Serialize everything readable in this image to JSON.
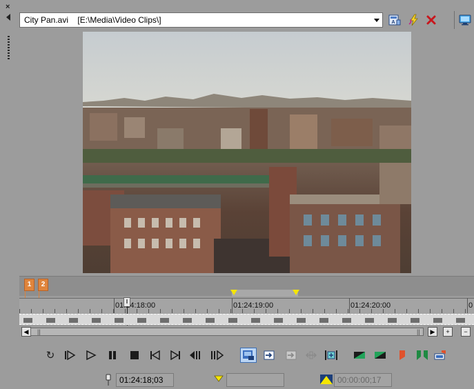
{
  "window": {
    "close_glyph": "×"
  },
  "toolbar": {
    "media_file": "City Pan.avi",
    "media_path": "[E:\\Media\\Video Clips\\]",
    "icons": [
      "media-properties-icon",
      "use-project-in-place-icon",
      "clear-trimmer-history-icon",
      "display-options-icon"
    ]
  },
  "timeline": {
    "markers": [
      {
        "label": "1"
      },
      {
        "label": "2"
      }
    ],
    "ruler_labels": [
      "01:24:18:00",
      "01:24:19:00",
      "01:24:20:00",
      "0"
    ],
    "cursor_label": "01:24:18:00"
  },
  "scrollbar": {
    "grip_left": "||",
    "grip_right": "||"
  },
  "transport": {
    "buttons": [
      "loop-playback-icon",
      "play-from-start-icon",
      "play-icon",
      "pause-icon",
      "stop-icon",
      "go-to-start-icon",
      "go-to-end-icon",
      "previous-frame-icon",
      "next-frame-icon",
      "snap-icon",
      "add-to-timeline-icon",
      "add-to-timeline-before-icon",
      "fit-to-fill-icon",
      "trim-selection-icon",
      "mark-in-icon",
      "mark-out-icon",
      "insert-marker-icon",
      "insert-region-icon",
      "create-subclip-icon"
    ]
  },
  "status": {
    "cursor_time": "01:24:18;03",
    "selection_time": "",
    "loop_length": "00:00:00;17"
  },
  "colors": {
    "marker": "#e0853c",
    "loop_handle": "#f5e600",
    "background": "#9c9c9c"
  }
}
